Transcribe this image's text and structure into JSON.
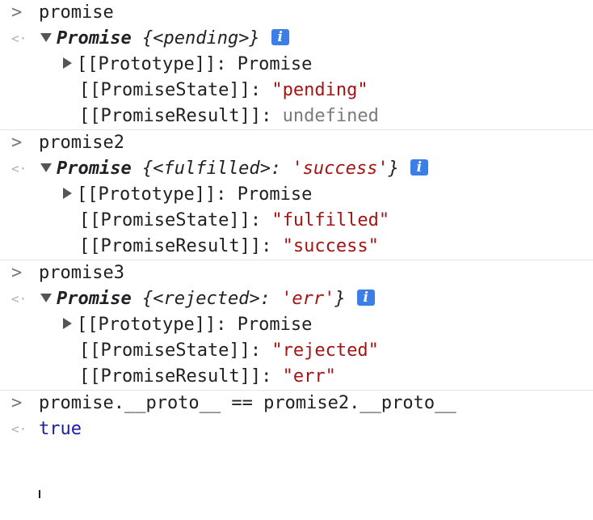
{
  "entries": [
    {
      "input": "promise",
      "summary_label": "Promise",
      "summary_open": "{<",
      "summary_state": "pending",
      "summary_close": ">}",
      "summary_value": "",
      "props": [
        {
          "name": "[[Prototype]]: ",
          "value": "Promise",
          "expandable": true,
          "kind": "plain"
        },
        {
          "name": "[[PromiseState]]: ",
          "value": "\"pending\"",
          "expandable": false,
          "kind": "string"
        },
        {
          "name": "[[PromiseResult]]: ",
          "value": "undefined",
          "expandable": false,
          "kind": "grey"
        }
      ]
    },
    {
      "input": "promise2",
      "summary_label": "Promise",
      "summary_open": "{<",
      "summary_state": "fulfilled",
      "summary_close": ">: ",
      "summary_value": "'success'",
      "summary_end": "}",
      "props": [
        {
          "name": "[[Prototype]]: ",
          "value": "Promise",
          "expandable": true,
          "kind": "plain"
        },
        {
          "name": "[[PromiseState]]: ",
          "value": "\"fulfilled\"",
          "expandable": false,
          "kind": "string"
        },
        {
          "name": "[[PromiseResult]]: ",
          "value": "\"success\"",
          "expandable": false,
          "kind": "string"
        }
      ]
    },
    {
      "input": "promise3",
      "summary_label": "Promise",
      "summary_open": "{<",
      "summary_state": "rejected",
      "summary_close": ">: ",
      "summary_value": "'err'",
      "summary_end": "}",
      "props": [
        {
          "name": "[[Prototype]]: ",
          "value": "Promise",
          "expandable": true,
          "kind": "plain"
        },
        {
          "name": "[[PromiseState]]: ",
          "value": "\"rejected\"",
          "expandable": false,
          "kind": "string"
        },
        {
          "name": "[[PromiseResult]]: ",
          "value": "\"err\"",
          "expandable": false,
          "kind": "string"
        }
      ]
    }
  ],
  "final": {
    "input": "promise.__proto__ == promise2.__proto__",
    "output": "true"
  },
  "icons": {
    "input_prompt": "chevron-right-icon",
    "output_prompt": "return-arrow-icon",
    "info": "info-icon"
  },
  "glyphs": {
    "input_prompt": ">",
    "output_prompt": "<·",
    "info": "i"
  },
  "colors": {
    "string": "#a31515",
    "undefined": "#7a7a7a",
    "boolean": "#1a1aa6",
    "info_badge": "#3a7ee6"
  }
}
